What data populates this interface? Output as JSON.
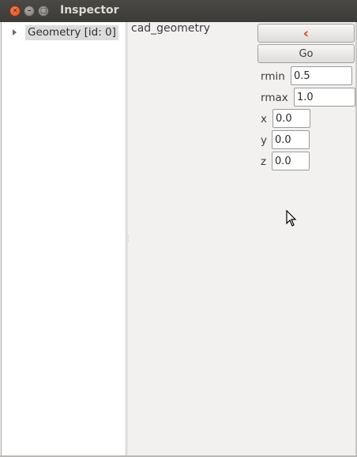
{
  "window": {
    "title": "Inspector",
    "close_glyph": "✕",
    "min_glyph": "–",
    "max_glyph": "□"
  },
  "tree": {
    "items": [
      {
        "label": "Geometry [id: 0]",
        "expanded": false
      }
    ]
  },
  "panel": {
    "geometry_name": "cad_geometry",
    "back_glyph": "‹",
    "back_icon": "chevron-left-icon",
    "go_label": "Go",
    "accent_color": "#dd4814",
    "fields": {
      "rmin": {
        "label": "rmin",
        "value": "0.5"
      },
      "rmax": {
        "label": "rmax",
        "value": "1.0"
      },
      "x": {
        "label": "x",
        "value": "0.0"
      },
      "y": {
        "label": "y",
        "value": "0.0"
      },
      "z": {
        "label": "z",
        "value": "0.0"
      }
    }
  }
}
